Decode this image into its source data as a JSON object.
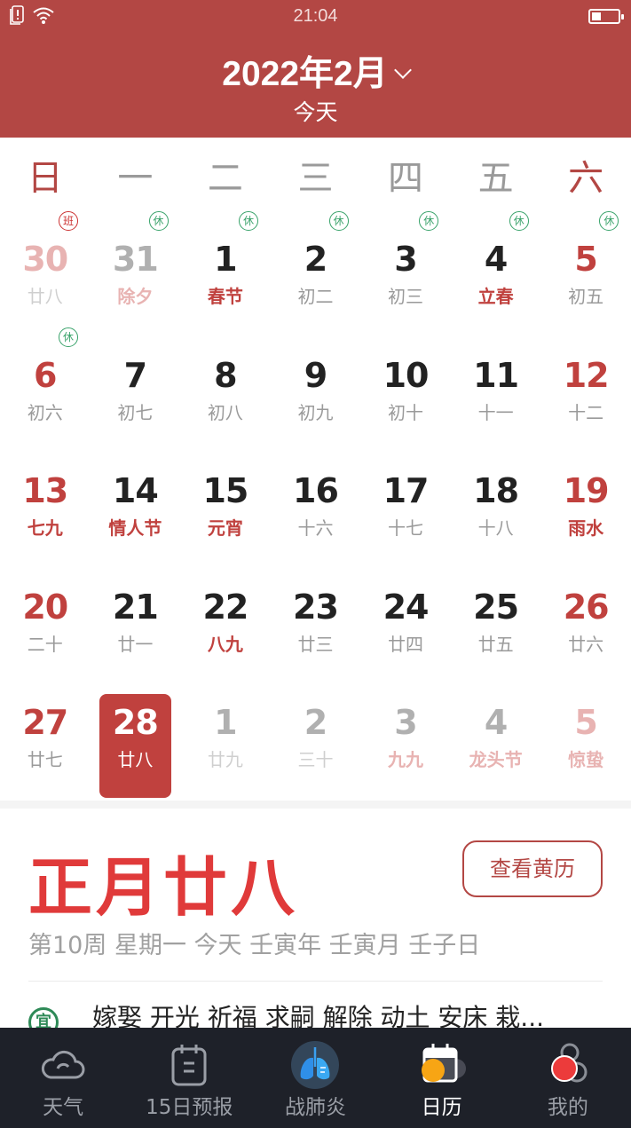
{
  "status_bar": {
    "time": "21:04",
    "battery_level": 0.35
  },
  "header": {
    "month_title": "2022年2月",
    "today_label": "今天",
    "accent_color": "#b34744"
  },
  "weekdays": [
    {
      "label": "日",
      "weekend": true
    },
    {
      "label": "一",
      "weekend": false
    },
    {
      "label": "二",
      "weekend": false
    },
    {
      "label": "三",
      "weekend": false
    },
    {
      "label": "四",
      "weekend": false
    },
    {
      "label": "五",
      "weekend": false
    },
    {
      "label": "六",
      "weekend": true
    }
  ],
  "calendar": {
    "weeks": [
      [
        {
          "day": "30",
          "lunar": "廿八",
          "other": true,
          "weekend": true,
          "badge": "班",
          "badge_type": "work"
        },
        {
          "day": "31",
          "lunar": "除夕",
          "other": true,
          "festival": true,
          "badge": "休",
          "badge_type": "rest"
        },
        {
          "day": "1",
          "lunar": "春节",
          "festival": true,
          "badge": "休",
          "badge_type": "rest"
        },
        {
          "day": "2",
          "lunar": "初二",
          "badge": "休",
          "badge_type": "rest"
        },
        {
          "day": "3",
          "lunar": "初三",
          "badge": "休",
          "badge_type": "rest"
        },
        {
          "day": "4",
          "lunar": "立春",
          "festival": true,
          "badge": "休",
          "badge_type": "rest"
        },
        {
          "day": "5",
          "lunar": "初五",
          "weekend": true,
          "badge": "休",
          "badge_type": "rest"
        }
      ],
      [
        {
          "day": "6",
          "lunar": "初六",
          "weekend": true,
          "badge": "休",
          "badge_type": "rest"
        },
        {
          "day": "7",
          "lunar": "初七"
        },
        {
          "day": "8",
          "lunar": "初八"
        },
        {
          "day": "9",
          "lunar": "初九"
        },
        {
          "day": "10",
          "lunar": "初十"
        },
        {
          "day": "11",
          "lunar": "十一"
        },
        {
          "day": "12",
          "lunar": "十二",
          "weekend": true
        }
      ],
      [
        {
          "day": "13",
          "lunar": "七九",
          "weekend": true,
          "festival": true
        },
        {
          "day": "14",
          "lunar": "情人节",
          "festival": true
        },
        {
          "day": "15",
          "lunar": "元宵",
          "festival": true
        },
        {
          "day": "16",
          "lunar": "十六"
        },
        {
          "day": "17",
          "lunar": "十七"
        },
        {
          "day": "18",
          "lunar": "十八"
        },
        {
          "day": "19",
          "lunar": "雨水",
          "weekend": true,
          "festival": true
        }
      ],
      [
        {
          "day": "20",
          "lunar": "二十",
          "weekend": true
        },
        {
          "day": "21",
          "lunar": "廿一"
        },
        {
          "day": "22",
          "lunar": "八九",
          "festival": true
        },
        {
          "day": "23",
          "lunar": "廿三"
        },
        {
          "day": "24",
          "lunar": "廿四"
        },
        {
          "day": "25",
          "lunar": "廿五"
        },
        {
          "day": "26",
          "lunar": "廿六",
          "weekend": true
        }
      ],
      [
        {
          "day": "27",
          "lunar": "廿七",
          "weekend": true
        },
        {
          "day": "28",
          "lunar": "廿八",
          "selected": true
        },
        {
          "day": "1",
          "lunar": "廿九",
          "other": true
        },
        {
          "day": "2",
          "lunar": "三十",
          "other": true
        },
        {
          "day": "3",
          "lunar": "九九",
          "other": true,
          "festival": true
        },
        {
          "day": "4",
          "lunar": "龙头节",
          "other": true,
          "festival": true
        },
        {
          "day": "5",
          "lunar": "惊蛰",
          "other": true,
          "weekend": true,
          "festival": true
        }
      ]
    ]
  },
  "detail": {
    "lunar_date": "正月廿八",
    "almanac_button": "查看黄历",
    "meta": "第10周 星期一 今天 壬寅年 壬寅月 壬子日",
    "yi_icon": "宜",
    "yi_text": "嫁娶 开光 祈福 求嗣 解除 动土 安床 栽..."
  },
  "tabbar": {
    "items": [
      {
        "label": "天气",
        "icon": "cloud-icon",
        "active": false
      },
      {
        "label": "15日预报",
        "icon": "forecast-calendar-icon",
        "active": false
      },
      {
        "label": "战肺炎",
        "icon": "lungs-icon",
        "active": false
      },
      {
        "label": "日历",
        "icon": "calendar-icon",
        "active": true
      },
      {
        "label": "我的",
        "icon": "profile-icon",
        "active": false
      }
    ]
  }
}
